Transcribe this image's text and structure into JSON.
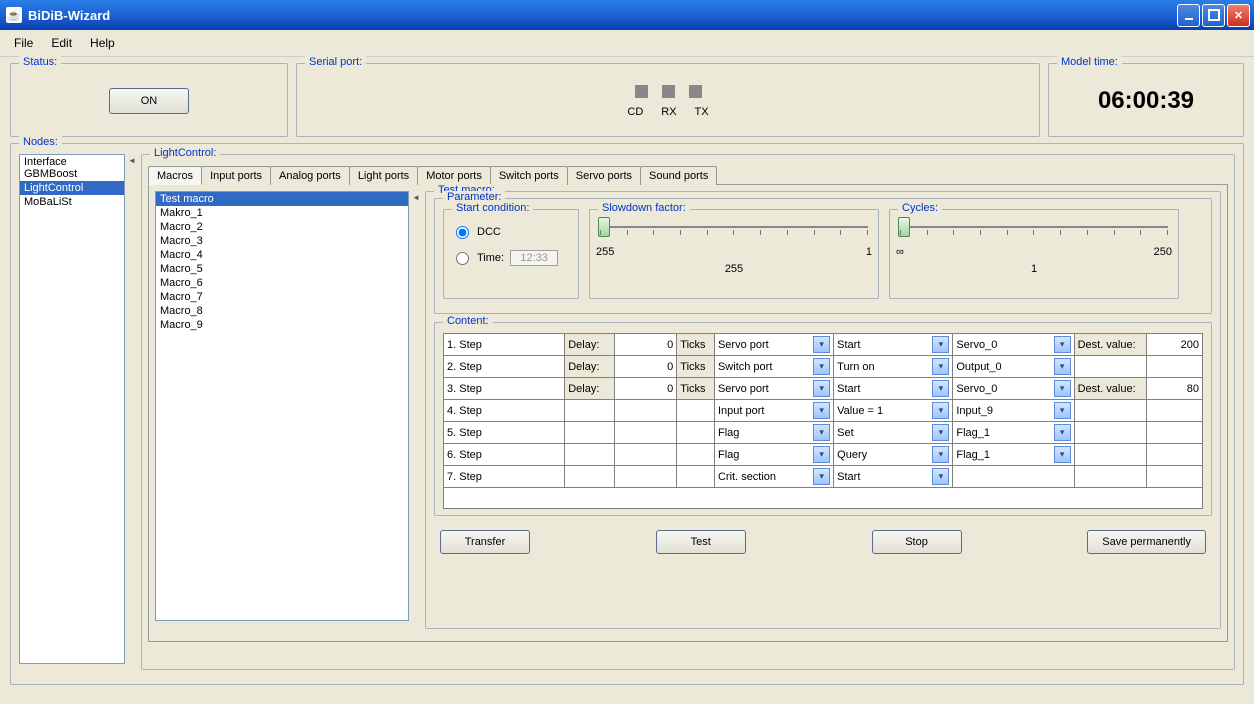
{
  "window": {
    "title": "BiDiB-Wizard"
  },
  "menu": {
    "file": "File",
    "edit": "Edit",
    "help": "Help"
  },
  "status": {
    "legend": "Status:",
    "on": "ON"
  },
  "serial": {
    "legend": "Serial port:",
    "cd": "CD",
    "rx": "RX",
    "tx": "TX"
  },
  "model": {
    "legend": "Model time:",
    "time": "06:00:39"
  },
  "nodes": {
    "legend": "Nodes:",
    "items": [
      "Interface GBMBoost",
      "LightControl",
      "MoBaLiSt"
    ],
    "selected": 1
  },
  "lightcontrol": {
    "legend": "LightControl:",
    "tabs": [
      "Macros",
      "Input ports",
      "Analog ports",
      "Light ports",
      "Motor ports",
      "Switch ports",
      "Servo ports",
      "Sound ports"
    ],
    "active_tab": 0,
    "macros": [
      "Test macro",
      "Makro_1",
      "Macro_2",
      "Macro_3",
      "Macro_4",
      "Macro_5",
      "Macro_6",
      "Macro_7",
      "Macro_8",
      "Macro_9"
    ],
    "selected_macro": 0,
    "detail": {
      "legend": "Test macro:",
      "param_legend": "Parameter:",
      "start": {
        "legend": "Start condition:",
        "dcc": "DCC",
        "time": "Time:",
        "time_value": "12:33"
      },
      "slowdown": {
        "legend": "Slowdown factor:",
        "min": "255",
        "max": "1",
        "value": "255"
      },
      "cycles": {
        "legend": "Cycles:",
        "min": "∞",
        "max": "250",
        "value": "1"
      },
      "content_legend": "Content:",
      "labels": {
        "delay": "Delay:",
        "ticks": "Ticks",
        "dest_value": "Dest. value:"
      },
      "steps": [
        {
          "n": "1. Step",
          "delay": "0",
          "ticks": true,
          "ptype": "Servo port",
          "action": "Start",
          "target": "Servo_0",
          "dest": "200"
        },
        {
          "n": "2. Step",
          "delay": "0",
          "ticks": true,
          "ptype": "Switch port",
          "action": "Turn on",
          "target": "Output_0",
          "dest": ""
        },
        {
          "n": "3. Step",
          "delay": "0",
          "ticks": true,
          "ptype": "Servo port",
          "action": "Start",
          "target": "Servo_0",
          "dest": "80"
        },
        {
          "n": "4. Step",
          "delay": "",
          "ticks": false,
          "ptype": "Input port",
          "action": "Value = 1",
          "target": "Input_9",
          "dest": ""
        },
        {
          "n": "5. Step",
          "delay": "",
          "ticks": false,
          "ptype": "Flag",
          "action": "Set",
          "target": "Flag_1",
          "dest": ""
        },
        {
          "n": "6. Step",
          "delay": "",
          "ticks": false,
          "ptype": "Flag",
          "action": "Query",
          "target": "Flag_1",
          "dest": ""
        },
        {
          "n": "7. Step",
          "delay": "",
          "ticks": false,
          "ptype": "Crit. section",
          "action": "Start",
          "target": "",
          "dest": ""
        }
      ],
      "buttons": {
        "transfer": "Transfer",
        "test": "Test",
        "stop": "Stop",
        "save": "Save permanently"
      }
    }
  }
}
